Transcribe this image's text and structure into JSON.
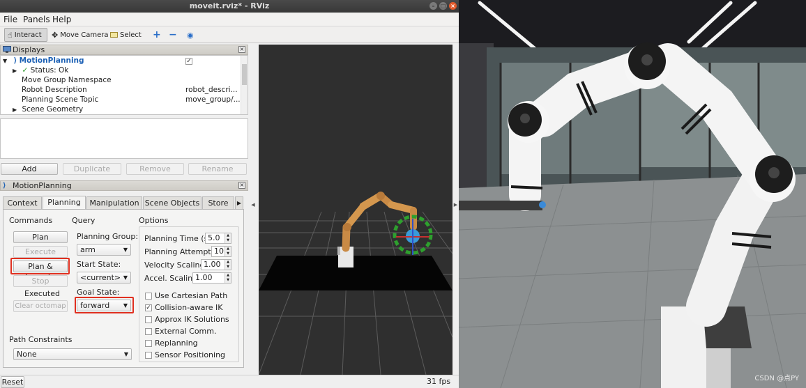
{
  "window": {
    "title": "moveit.rviz* - RViz"
  },
  "menu": {
    "file": "File",
    "panels": "Panels",
    "help": "Help"
  },
  "toolbar": {
    "interact": "Interact",
    "move_camera": "Move Camera",
    "select": "Select"
  },
  "displays": {
    "title": "Displays",
    "tree": [
      {
        "label": "MotionPlanning",
        "value": ""
      },
      {
        "label": "Status: Ok",
        "value": ""
      },
      {
        "label": "Move Group Namespace",
        "value": ""
      },
      {
        "label": "Robot Description",
        "value": "robot_descri..."
      },
      {
        "label": "Planning Scene Topic",
        "value": "move_group/..."
      },
      {
        "label": "Scene Geometry",
        "value": ""
      }
    ],
    "buttons": {
      "add": "Add",
      "duplicate": "Duplicate",
      "remove": "Remove",
      "rename": "Rename"
    }
  },
  "motion_planning": {
    "title": "MotionPlanning",
    "tabs": [
      "Context",
      "Planning",
      "Manipulation",
      "Scene Objects",
      "Store"
    ],
    "selected_tab": "Planning",
    "commands": {
      "header": "Commands",
      "plan": "Plan",
      "execute": "Execute",
      "plan_execute": "Plan & Execute",
      "stop": "Stop",
      "status": "Executed",
      "clear_octomap": "Clear octomap"
    },
    "query": {
      "header": "Query",
      "planning_group_label": "Planning Group:",
      "planning_group": "arm",
      "start_state_label": "Start State:",
      "start_state": "<current>",
      "goal_state_label": "Goal State:",
      "goal_state": "forward"
    },
    "options": {
      "header": "Options",
      "planning_time_label": "Planning Time (s):",
      "planning_time": "5.0",
      "planning_attempts_label": "Planning Attempts:",
      "planning_attempts": "10",
      "velocity_scaling_label": "Velocity Scaling:",
      "velocity_scaling": "1.00",
      "accel_scaling_label": "Accel. Scaling:",
      "accel_scaling": "1.00",
      "use_cartesian_path": "Use Cartesian Path",
      "collision_aware_ik": "Collision-aware IK",
      "approx_ik": "Approx IK Solutions",
      "external_comm": "External Comm.",
      "replanning": "Replanning",
      "sensor_positioning": "Sensor Positioning"
    },
    "path_constraints": {
      "label": "Path Constraints",
      "value": "None"
    }
  },
  "status_bar": {
    "reset": "Reset",
    "fps": "31 fps"
  },
  "watermark": "CSDN @点PY",
  "colors": {
    "highlight": "#e03020",
    "link": "#1a5fb4"
  }
}
